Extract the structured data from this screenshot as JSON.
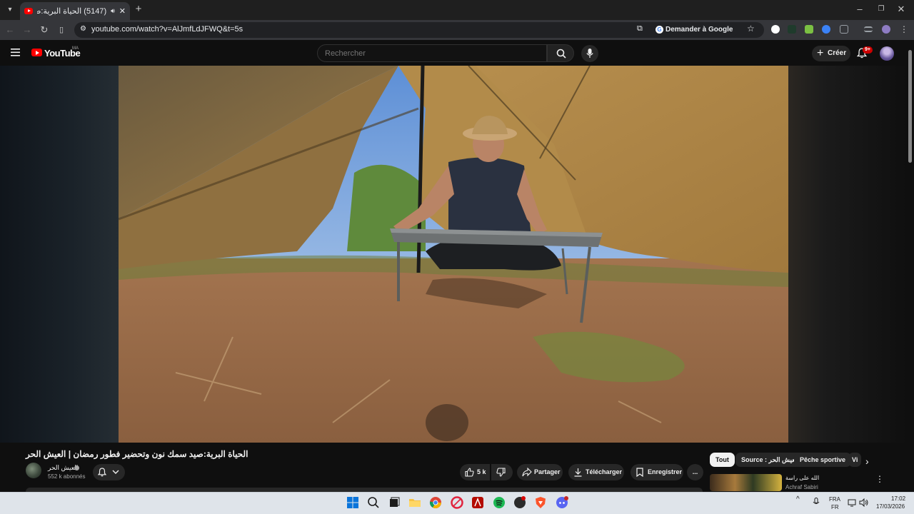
{
  "browser": {
    "tab_title": "(5147) الحياة البرية:صيد سمك",
    "url": "youtube.com/watch?v=AlJmfLdJFWQ&t=5s",
    "ask_google_label": "Demander à Google"
  },
  "youtube": {
    "logo_text": "YouTube",
    "country_code": "MA",
    "search_placeholder": "Rechercher",
    "create_label": "Créer",
    "notification_count": "9+"
  },
  "video": {
    "title": "الحياة البرية:صيد سمك نون وتحضير فطور رمضان | العيش الحر",
    "channel_name": "العيش الحر",
    "subscribers": "552 k abonnés",
    "like_count": "5 k",
    "share_label": "Partager",
    "download_label": "Télécharger",
    "save_label": "Enregistrer",
    "more_label": "..."
  },
  "chips": {
    "all": "Tout",
    "source": "Source : العيش الحر",
    "fishing": "Pêche sportive",
    "more": "Vi"
  },
  "recommendation": {
    "title": "الله على راسة",
    "channel": "Achraf Sabiri"
  },
  "taskbar": {
    "lang_top": "FRA",
    "lang_bottom": "FR",
    "time": "17:02",
    "date": "17/03/2026"
  },
  "colors": {
    "youtube_red": "#ff0000",
    "background": "#0f0f0f",
    "button_bg": "#272727",
    "tent_fabric": "#a07f4a",
    "taskbar": "#dfe4ea"
  }
}
